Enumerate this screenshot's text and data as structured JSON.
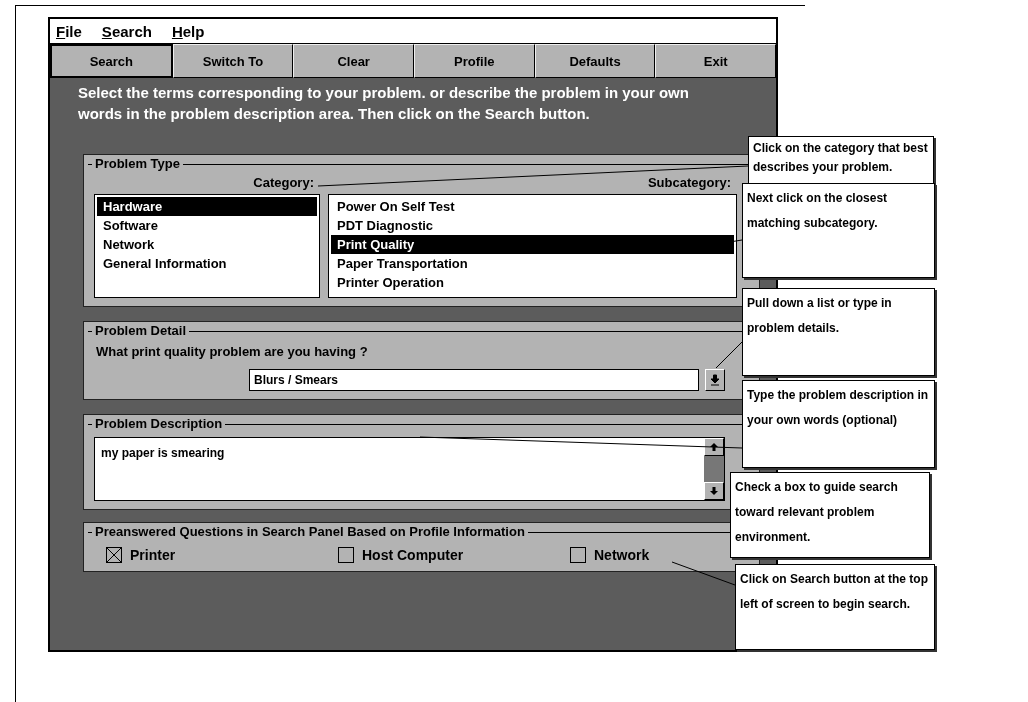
{
  "menu": [
    {
      "label": "File"
    },
    {
      "label": "Search"
    },
    {
      "label": "Help"
    }
  ],
  "toolbar": [
    {
      "label": "Search",
      "default": true
    },
    {
      "label": "Switch To",
      "default": false
    },
    {
      "label": "Clear",
      "default": false
    },
    {
      "label": "Profile",
      "default": false
    },
    {
      "label": "Defaults",
      "default": false
    },
    {
      "label": "Exit",
      "default": false
    }
  ],
  "instructions": "Select the terms corresponding to your problem. or describe the problem in your own words in the problem description area. Then click on the Search button.",
  "problem_type": {
    "title": "Problem Type",
    "category_label": "Category:",
    "subcategory_label": "Subcategory:",
    "categories": [
      {
        "label": "Hardware",
        "selected": true
      },
      {
        "label": "Software",
        "selected": false
      },
      {
        "label": "Network",
        "selected": false
      },
      {
        "label": "General Information",
        "selected": false
      }
    ],
    "subcategories": [
      {
        "label": "Power On Self Test",
        "selected": false
      },
      {
        "label": "PDT Diagnostic",
        "selected": false
      },
      {
        "label": "Print Quality",
        "selected": true
      },
      {
        "label": "Paper Transportation",
        "selected": false
      },
      {
        "label": "Printer Operation",
        "selected": false
      }
    ]
  },
  "problem_detail": {
    "title": "Problem Detail",
    "question": "What print quality problem are you having ?",
    "value": "Blurs / Smears"
  },
  "problem_description": {
    "title": "Problem Description",
    "value": "my paper is smearing"
  },
  "preanswered": {
    "title": "Preanswered Questions in Search Panel Based on Profile Information",
    "options": [
      {
        "label": "Printer",
        "checked": true
      },
      {
        "label": "Host Computer",
        "checked": false
      },
      {
        "label": "Network",
        "checked": false
      }
    ]
  },
  "callouts": [
    {
      "text": "Click on the category that best describes your problem."
    },
    {
      "text": "Next click  on the closest matching subcategory."
    },
    {
      "text": "Pull down a list or type in problem details."
    },
    {
      "text": "Type the problem description in your own words (optional)"
    },
    {
      "text": "Check a box to guide search toward relevant problem environment."
    },
    {
      "text": "Click on Search button at the top left of screen to  begin search."
    }
  ]
}
